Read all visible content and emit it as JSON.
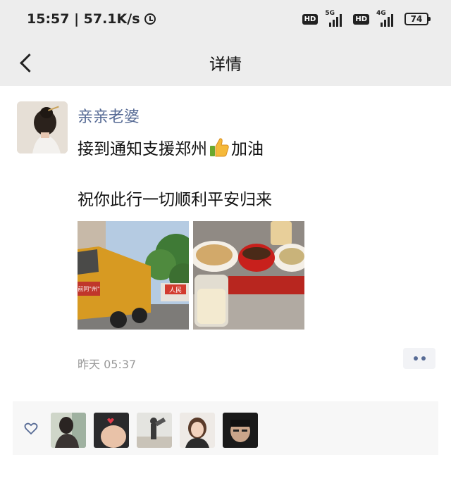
{
  "status_bar": {
    "time_speed": "15:57 | 57.1K/s",
    "hd_label": "HD",
    "network_1": "5G",
    "network_2": "4G",
    "battery": "74"
  },
  "nav": {
    "title": "详情"
  },
  "post": {
    "author": "亲亲老婆",
    "line1_a": "接到通知支援郑州",
    "line1_b": "加油",
    "line2": "祝你此行一切顺利平安归来",
    "truck_banner": "前同\"州\"",
    "building_sign": "人民",
    "time": "昨天 05:37"
  },
  "icons": [
    "alarm-icon",
    "back-icon",
    "thumbs-up-icon",
    "more-icon",
    "heart-icon"
  ],
  "colors": {
    "name_blue": "#576b95",
    "bar_bg": "#ededed",
    "likes_bg": "#f7f7f7"
  }
}
